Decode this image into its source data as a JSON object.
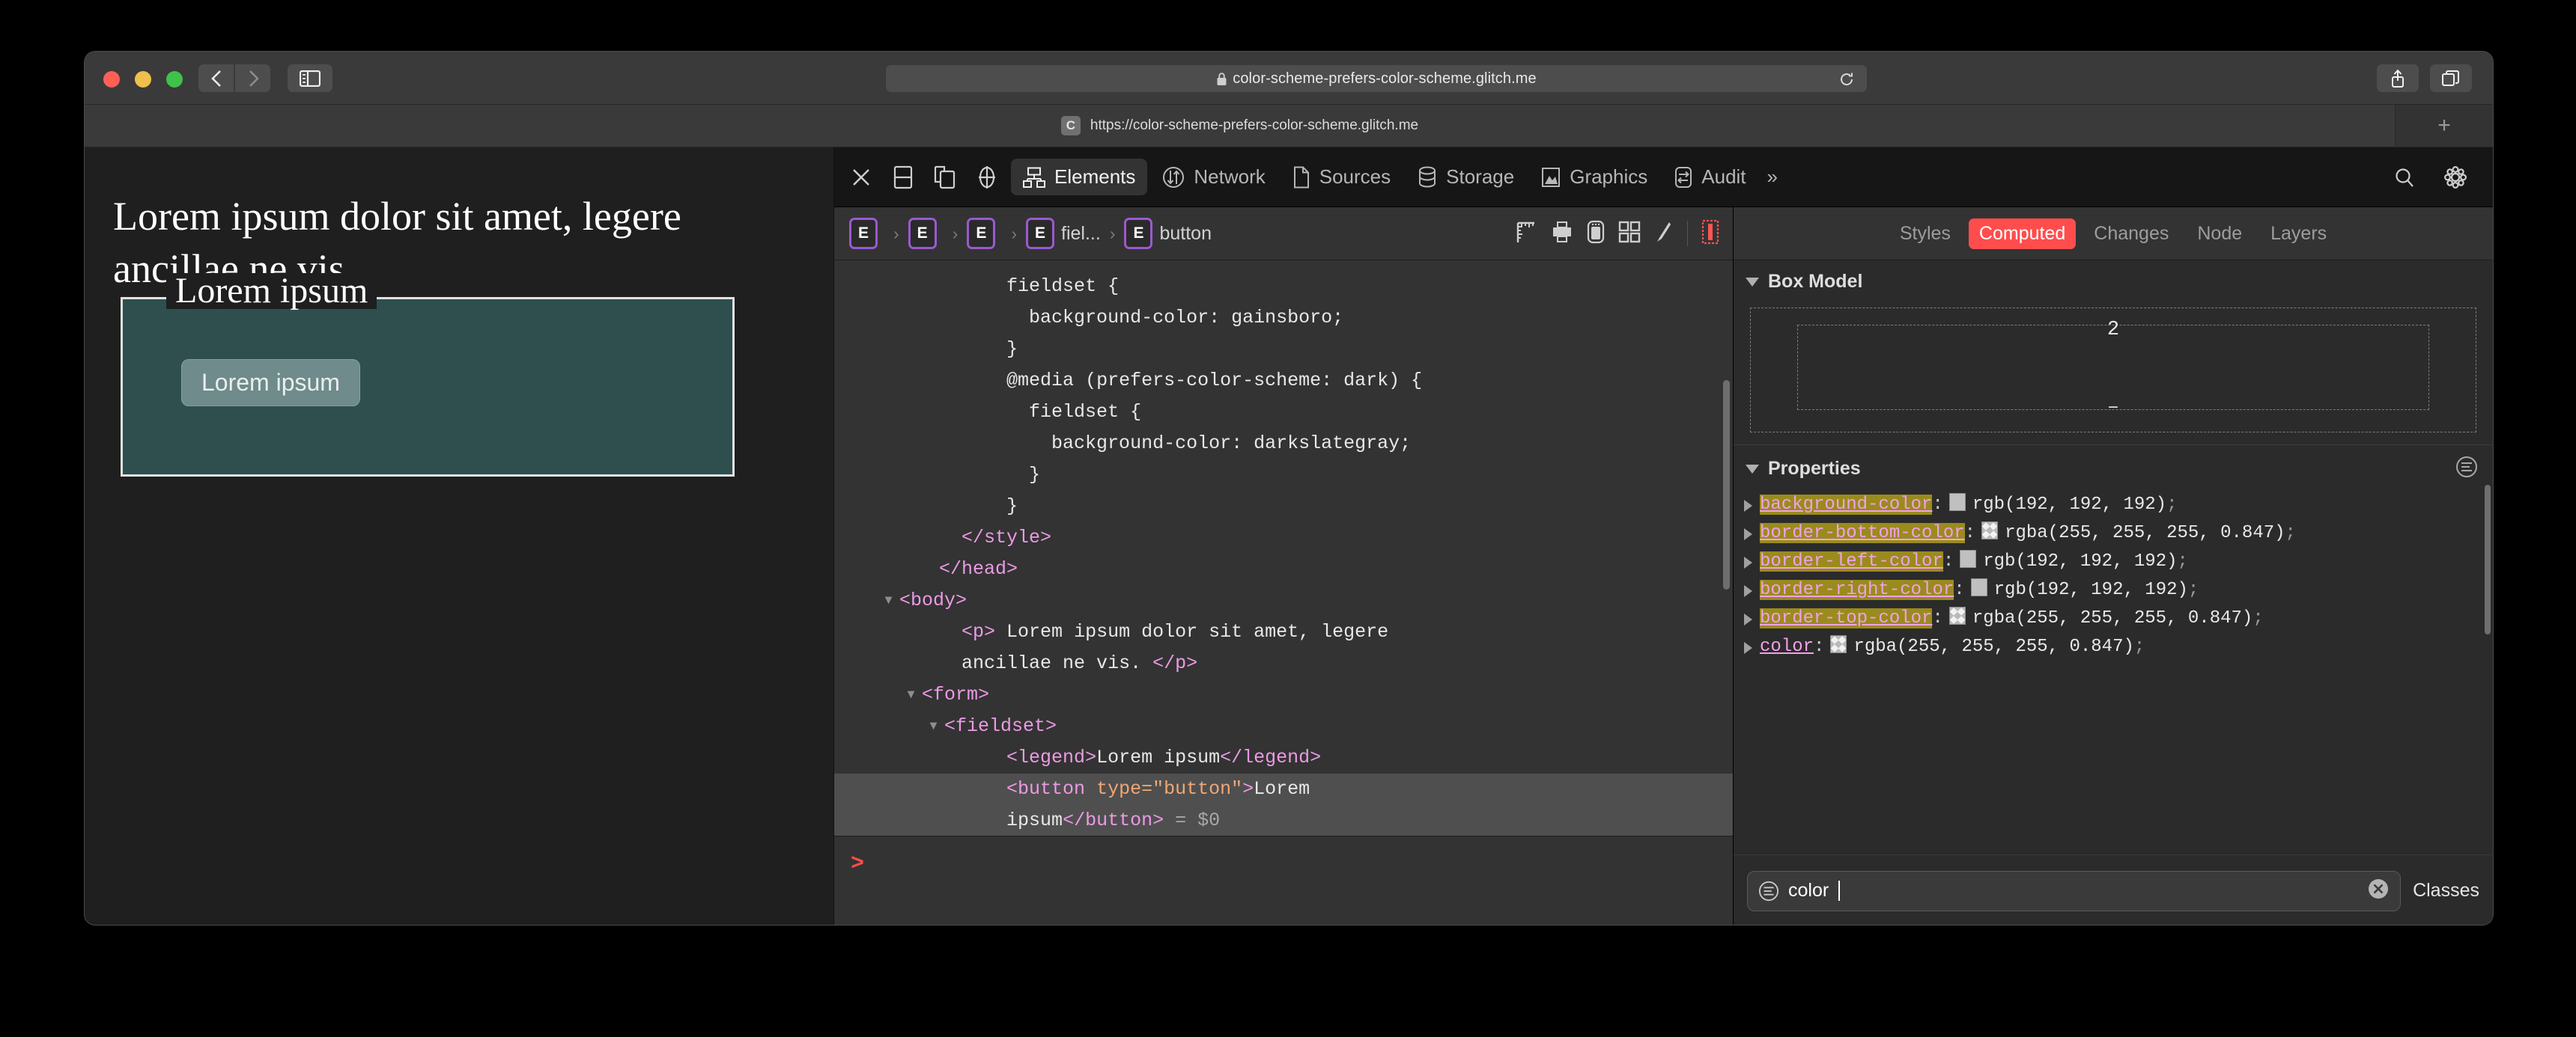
{
  "browser": {
    "url_display": "color-scheme-prefers-color-scheme.glitch.me",
    "reload_icon": "reload-icon",
    "back_icon": "back-chevron-icon",
    "forward_icon": "forward-chevron-icon",
    "sidebar_icon": "sidebar-toggle-icon",
    "share_icon": "share-icon",
    "tabs_icon": "show-tabs-icon",
    "lock_icon": "lock-icon",
    "tab": {
      "favicon_letter": "C",
      "title": "https://color-scheme-prefers-color-scheme.glitch.me"
    },
    "new_tab_label": "+"
  },
  "page": {
    "paragraph": "Lorem ipsum dolor sit amet, legere ancillae ne vis.",
    "legend": "Lorem ipsum",
    "button_label": "Lorem ipsum"
  },
  "inspector": {
    "tools": [
      "close-icon",
      "dock-bottom-icon",
      "dock-right-icon",
      "inspect-element-icon"
    ],
    "tabs": [
      {
        "label": "Elements",
        "icon": "elements-tree-icon",
        "active": true
      },
      {
        "label": "Network",
        "icon": "network-arrows-icon",
        "active": false
      },
      {
        "label": "Sources",
        "icon": "sources-file-icon",
        "active": false
      },
      {
        "label": "Storage",
        "icon": "storage-database-icon",
        "active": false
      },
      {
        "label": "Graphics",
        "icon": "graphics-image-icon",
        "active": false
      },
      {
        "label": "Audit",
        "icon": "audit-swap-icon",
        "active": false
      }
    ],
    "overflow_label": "»",
    "search_icon": "search-icon",
    "settings_icon": "gear-icon",
    "breadcrumb": [
      {
        "badge": "E",
        "name": ""
      },
      {
        "badge": "E",
        "name": ""
      },
      {
        "badge": "E",
        "name": ""
      },
      {
        "badge": "E",
        "name": "fiel..."
      },
      {
        "badge": "E",
        "name": "button"
      }
    ],
    "breadcrumb_tools": [
      "layout-ruler-icon",
      "print-icon",
      "device-icon",
      "grid-overlay-icon",
      "paintbrush-icon",
      "force-state-icon"
    ],
    "code_lines": [
      {
        "indent": 7,
        "selected": false,
        "parts": [
          {
            "t": "txt",
            "v": "fieldset {"
          }
        ]
      },
      {
        "indent": 8,
        "selected": false,
        "parts": [
          {
            "t": "txt",
            "v": "background-color: gainsboro;"
          }
        ]
      },
      {
        "indent": 7,
        "selected": false,
        "parts": [
          {
            "t": "txt",
            "v": "}"
          }
        ]
      },
      {
        "indent": 7,
        "selected": false,
        "parts": [
          {
            "t": "txt",
            "v": "@media (prefers-color-scheme: dark) {"
          }
        ]
      },
      {
        "indent": 8,
        "selected": false,
        "parts": [
          {
            "t": "txt",
            "v": "fieldset {"
          }
        ]
      },
      {
        "indent": 9,
        "selected": false,
        "parts": [
          {
            "t": "txt",
            "v": "background-color: darkslategray;"
          }
        ]
      },
      {
        "indent": 8,
        "selected": false,
        "parts": [
          {
            "t": "txt",
            "v": "}"
          }
        ]
      },
      {
        "indent": 7,
        "selected": false,
        "parts": [
          {
            "t": "txt",
            "v": "}"
          }
        ]
      },
      {
        "indent": 5,
        "selected": false,
        "parts": [
          {
            "t": "tag",
            "v": "</style>"
          }
        ]
      },
      {
        "indent": 4,
        "selected": false,
        "parts": [
          {
            "t": "tag",
            "v": "</head>"
          }
        ]
      },
      {
        "indent": 3,
        "selected": false,
        "twisty": true,
        "parts": [
          {
            "t": "tag",
            "v": "<body>"
          }
        ]
      },
      {
        "indent": 5,
        "selected": false,
        "parts": [
          {
            "t": "tag",
            "v": "<p>"
          },
          {
            "t": "txt",
            "v": " Lorem ipsum dolor sit amet, legere"
          }
        ]
      },
      {
        "indent": 5,
        "selected": false,
        "parts": [
          {
            "t": "txt",
            "v": "ancillae ne vis. "
          },
          {
            "t": "tag",
            "v": "</p>"
          }
        ]
      },
      {
        "indent": 4,
        "selected": false,
        "twisty": true,
        "parts": [
          {
            "t": "tag",
            "v": "<form>"
          }
        ]
      },
      {
        "indent": 5,
        "selected": false,
        "twisty": true,
        "parts": [
          {
            "t": "tag",
            "v": "<fieldset>"
          }
        ]
      },
      {
        "indent": 7,
        "selected": false,
        "parts": [
          {
            "t": "tag",
            "v": "<legend>"
          },
          {
            "t": "txt",
            "v": "Lorem ipsum"
          },
          {
            "t": "tag",
            "v": "</legend>"
          }
        ]
      },
      {
        "indent": 7,
        "selected": true,
        "parts": [
          {
            "t": "tag",
            "v": "<button "
          },
          {
            "t": "attr",
            "v": "type="
          },
          {
            "t": "val",
            "v": "\"button\""
          },
          {
            "t": "tag",
            "v": ">"
          },
          {
            "t": "txt",
            "v": "Lorem"
          }
        ]
      },
      {
        "indent": 7,
        "selected": true,
        "parts": [
          {
            "t": "txt",
            "v": "ipsum"
          },
          {
            "t": "tag",
            "v": "</button>"
          },
          {
            "t": "dollar",
            "v": " = $0"
          }
        ]
      }
    ],
    "console_prompt": ">"
  },
  "sidebar": {
    "tabs": [
      {
        "label": "Styles",
        "active": false
      },
      {
        "label": "Computed",
        "active": true
      },
      {
        "label": "Changes",
        "active": false
      },
      {
        "label": "Node",
        "active": false
      },
      {
        "label": "Layers",
        "active": false
      }
    ],
    "box_model": {
      "title": "Box Model",
      "top_value": "2",
      "bottom_value": "–"
    },
    "properties": {
      "title": "Properties",
      "filter_icon": "filter-icon",
      "items": [
        {
          "name": "background-color",
          "highlighted": true,
          "swatch": "#c0c0c0",
          "swatch_alpha": false,
          "value": "rgb(192, 192, 192)"
        },
        {
          "name": "border-bottom-color",
          "highlighted": true,
          "swatch": "#ffffff",
          "swatch_alpha": true,
          "value": "rgba(255, 255, 255, 0.847)"
        },
        {
          "name": "border-left-color",
          "highlighted": true,
          "swatch": "#c0c0c0",
          "swatch_alpha": false,
          "value": "rgb(192, 192, 192)"
        },
        {
          "name": "border-right-color",
          "highlighted": true,
          "swatch": "#c0c0c0",
          "swatch_alpha": false,
          "value": "rgb(192, 192, 192)"
        },
        {
          "name": "border-top-color",
          "highlighted": true,
          "swatch": "#ffffff",
          "swatch_alpha": true,
          "value": "rgba(255, 255, 255, 0.847)"
        },
        {
          "name": "color",
          "highlighted": false,
          "swatch": "#ffffff",
          "swatch_alpha": true,
          "value": "rgba(255, 255, 255, 0.847)"
        }
      ]
    },
    "filter": {
      "icon": "filter-icon",
      "value": "color",
      "clear_icon": "clear-icon",
      "classes_label": "Classes"
    },
    "accent_color": "#ff4d4d"
  }
}
